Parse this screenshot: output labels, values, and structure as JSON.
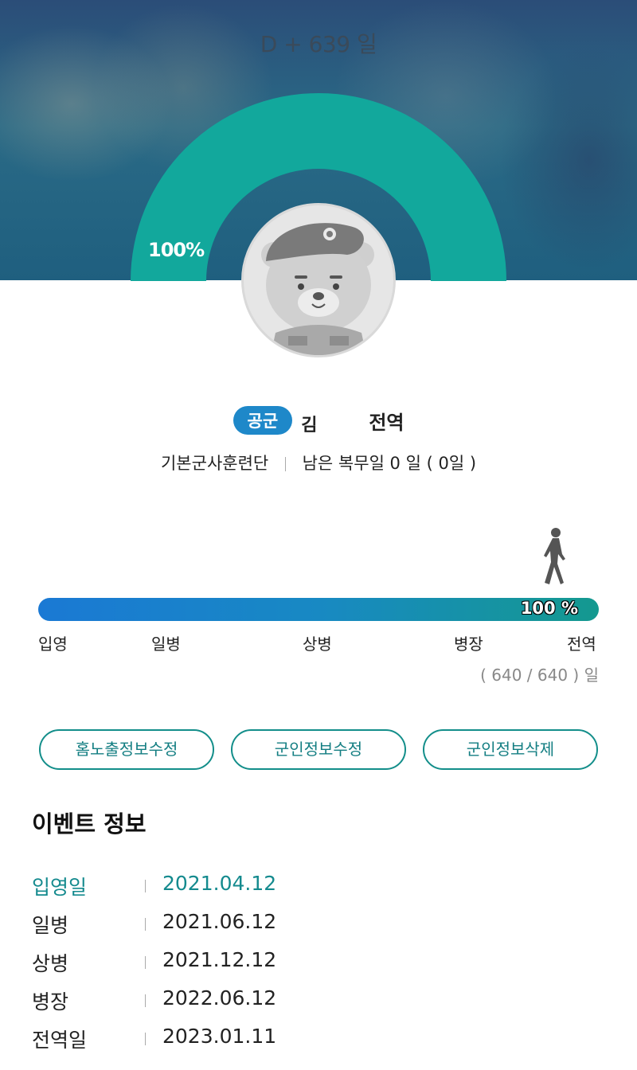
{
  "header": {
    "d_day": "D + 639 일",
    "arc_percent": "100%"
  },
  "profile": {
    "branch": "공군",
    "name_visible_start": "김",
    "name_visible_end": "",
    "status": "전역",
    "unit": "기본군사훈련단",
    "remaining": "남은 복무일 0 일 ( 0일 )"
  },
  "progress": {
    "percent_label": "100 %",
    "value_percent": 100,
    "ranks": [
      "입영",
      "일병",
      "상병",
      "병장",
      "전역"
    ],
    "days": "( 640 / 640 ) 일"
  },
  "actions": {
    "edit_home_leave": "홈노출정보수정",
    "edit_military_info": "군인정보수정",
    "delete_military_info": "군인정보삭제"
  },
  "events": {
    "title": "이벤트 정보",
    "rows": [
      {
        "label": "입영일",
        "date": "2021.04.12"
      },
      {
        "label": "일병",
        "date": "2021.06.12"
      },
      {
        "label": "상병",
        "date": "2021.12.12"
      },
      {
        "label": "병장",
        "date": "2022.06.12"
      },
      {
        "label": "전역일",
        "date": "2023.01.11"
      }
    ]
  },
  "colors": {
    "accent_teal": "#14998f",
    "progress_blue": "#1a79d4",
    "badge_blue": "#1e88c9",
    "arc_teal": "#12a89c"
  },
  "icons": {
    "walker": "walking-soldier-icon",
    "avatar": "bear-soldier-avatar"
  }
}
